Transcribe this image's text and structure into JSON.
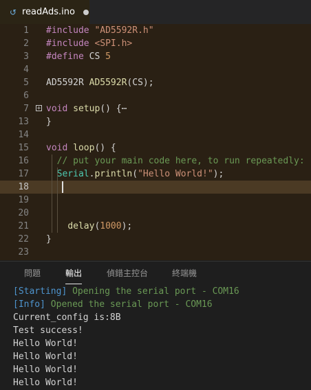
{
  "tab": {
    "icon": "arduino-file-icon",
    "filename": "readAds.ino"
  },
  "editor": {
    "lines": [
      {
        "n": "1",
        "tokens": [
          {
            "c": "kw",
            "t": "#include "
          },
          {
            "c": "str",
            "t": "\"AD5592R.h\""
          }
        ]
      },
      {
        "n": "2",
        "tokens": [
          {
            "c": "kw",
            "t": "#include "
          },
          {
            "c": "str",
            "t": "<SPI.h>"
          }
        ]
      },
      {
        "n": "3",
        "tokens": [
          {
            "c": "kw",
            "t": "#define "
          },
          {
            "c": "plain",
            "t": "CS "
          },
          {
            "c": "num",
            "t": "5"
          }
        ]
      },
      {
        "n": "4",
        "tokens": []
      },
      {
        "n": "5",
        "tokens": [
          {
            "c": "plain",
            "t": "AD5592R "
          },
          {
            "c": "fn",
            "t": "AD5592R"
          },
          {
            "c": "plain",
            "t": "(CS);"
          }
        ]
      },
      {
        "n": "6",
        "tokens": []
      },
      {
        "n": "7",
        "tokens": [
          {
            "c": "kw",
            "t": "void "
          },
          {
            "c": "fn",
            "t": "setup"
          },
          {
            "c": "plain",
            "t": "() {⋯"
          }
        ],
        "fold": "+"
      },
      {
        "n": "13",
        "tokens": [
          {
            "c": "plain",
            "t": "}"
          }
        ]
      },
      {
        "n": "14",
        "tokens": []
      },
      {
        "n": "15",
        "tokens": [
          {
            "c": "kw",
            "t": "void "
          },
          {
            "c": "fn",
            "t": "loop"
          },
          {
            "c": "plain",
            "t": "() {"
          }
        ]
      },
      {
        "n": "16",
        "tokens": [
          {
            "c": "cmt",
            "t": "  // put your main code here, to run repeatedly:"
          }
        ]
      },
      {
        "n": "17",
        "tokens": [
          {
            "c": "plain",
            "t": "  "
          },
          {
            "c": "type",
            "t": "Serial"
          },
          {
            "c": "plain",
            "t": "."
          },
          {
            "c": "fn",
            "t": "println"
          },
          {
            "c": "plain",
            "t": "("
          },
          {
            "c": "str",
            "t": "\"Hello World!\""
          },
          {
            "c": "plain",
            "t": ");"
          }
        ]
      },
      {
        "n": "18",
        "tokens": [],
        "active": true
      },
      {
        "n": "19",
        "tokens": []
      },
      {
        "n": "20",
        "tokens": []
      },
      {
        "n": "21",
        "tokens": [
          {
            "c": "plain",
            "t": "    "
          },
          {
            "c": "fn",
            "t": "delay"
          },
          {
            "c": "plain",
            "t": "("
          },
          {
            "c": "num",
            "t": "1000"
          },
          {
            "c": "plain",
            "t": ");"
          }
        ]
      },
      {
        "n": "22",
        "tokens": [
          {
            "c": "plain",
            "t": "}"
          }
        ]
      },
      {
        "n": "23",
        "tokens": []
      }
    ]
  },
  "panel": {
    "tabs": [
      {
        "label": "問題",
        "name": "tab-problems",
        "active": false
      },
      {
        "label": "輸出",
        "name": "tab-output",
        "active": true
      },
      {
        "label": "偵錯主控台",
        "name": "tab-debug-console",
        "active": false
      },
      {
        "label": "終端機",
        "name": "tab-terminal",
        "active": false
      }
    ],
    "output": [
      {
        "tag": "[Starting]",
        "msg": " Opening the serial port - COM16"
      },
      {
        "tag": "[Info]",
        "msg": " Opened the serial port - COM16"
      },
      {
        "text": "Current_config is:8B"
      },
      {
        "text": "Test success!"
      },
      {
        "text": "Hello World!"
      },
      {
        "text": "Hello World!"
      },
      {
        "text": "Hello World!"
      },
      {
        "text": "Hello World!"
      }
    ]
  }
}
